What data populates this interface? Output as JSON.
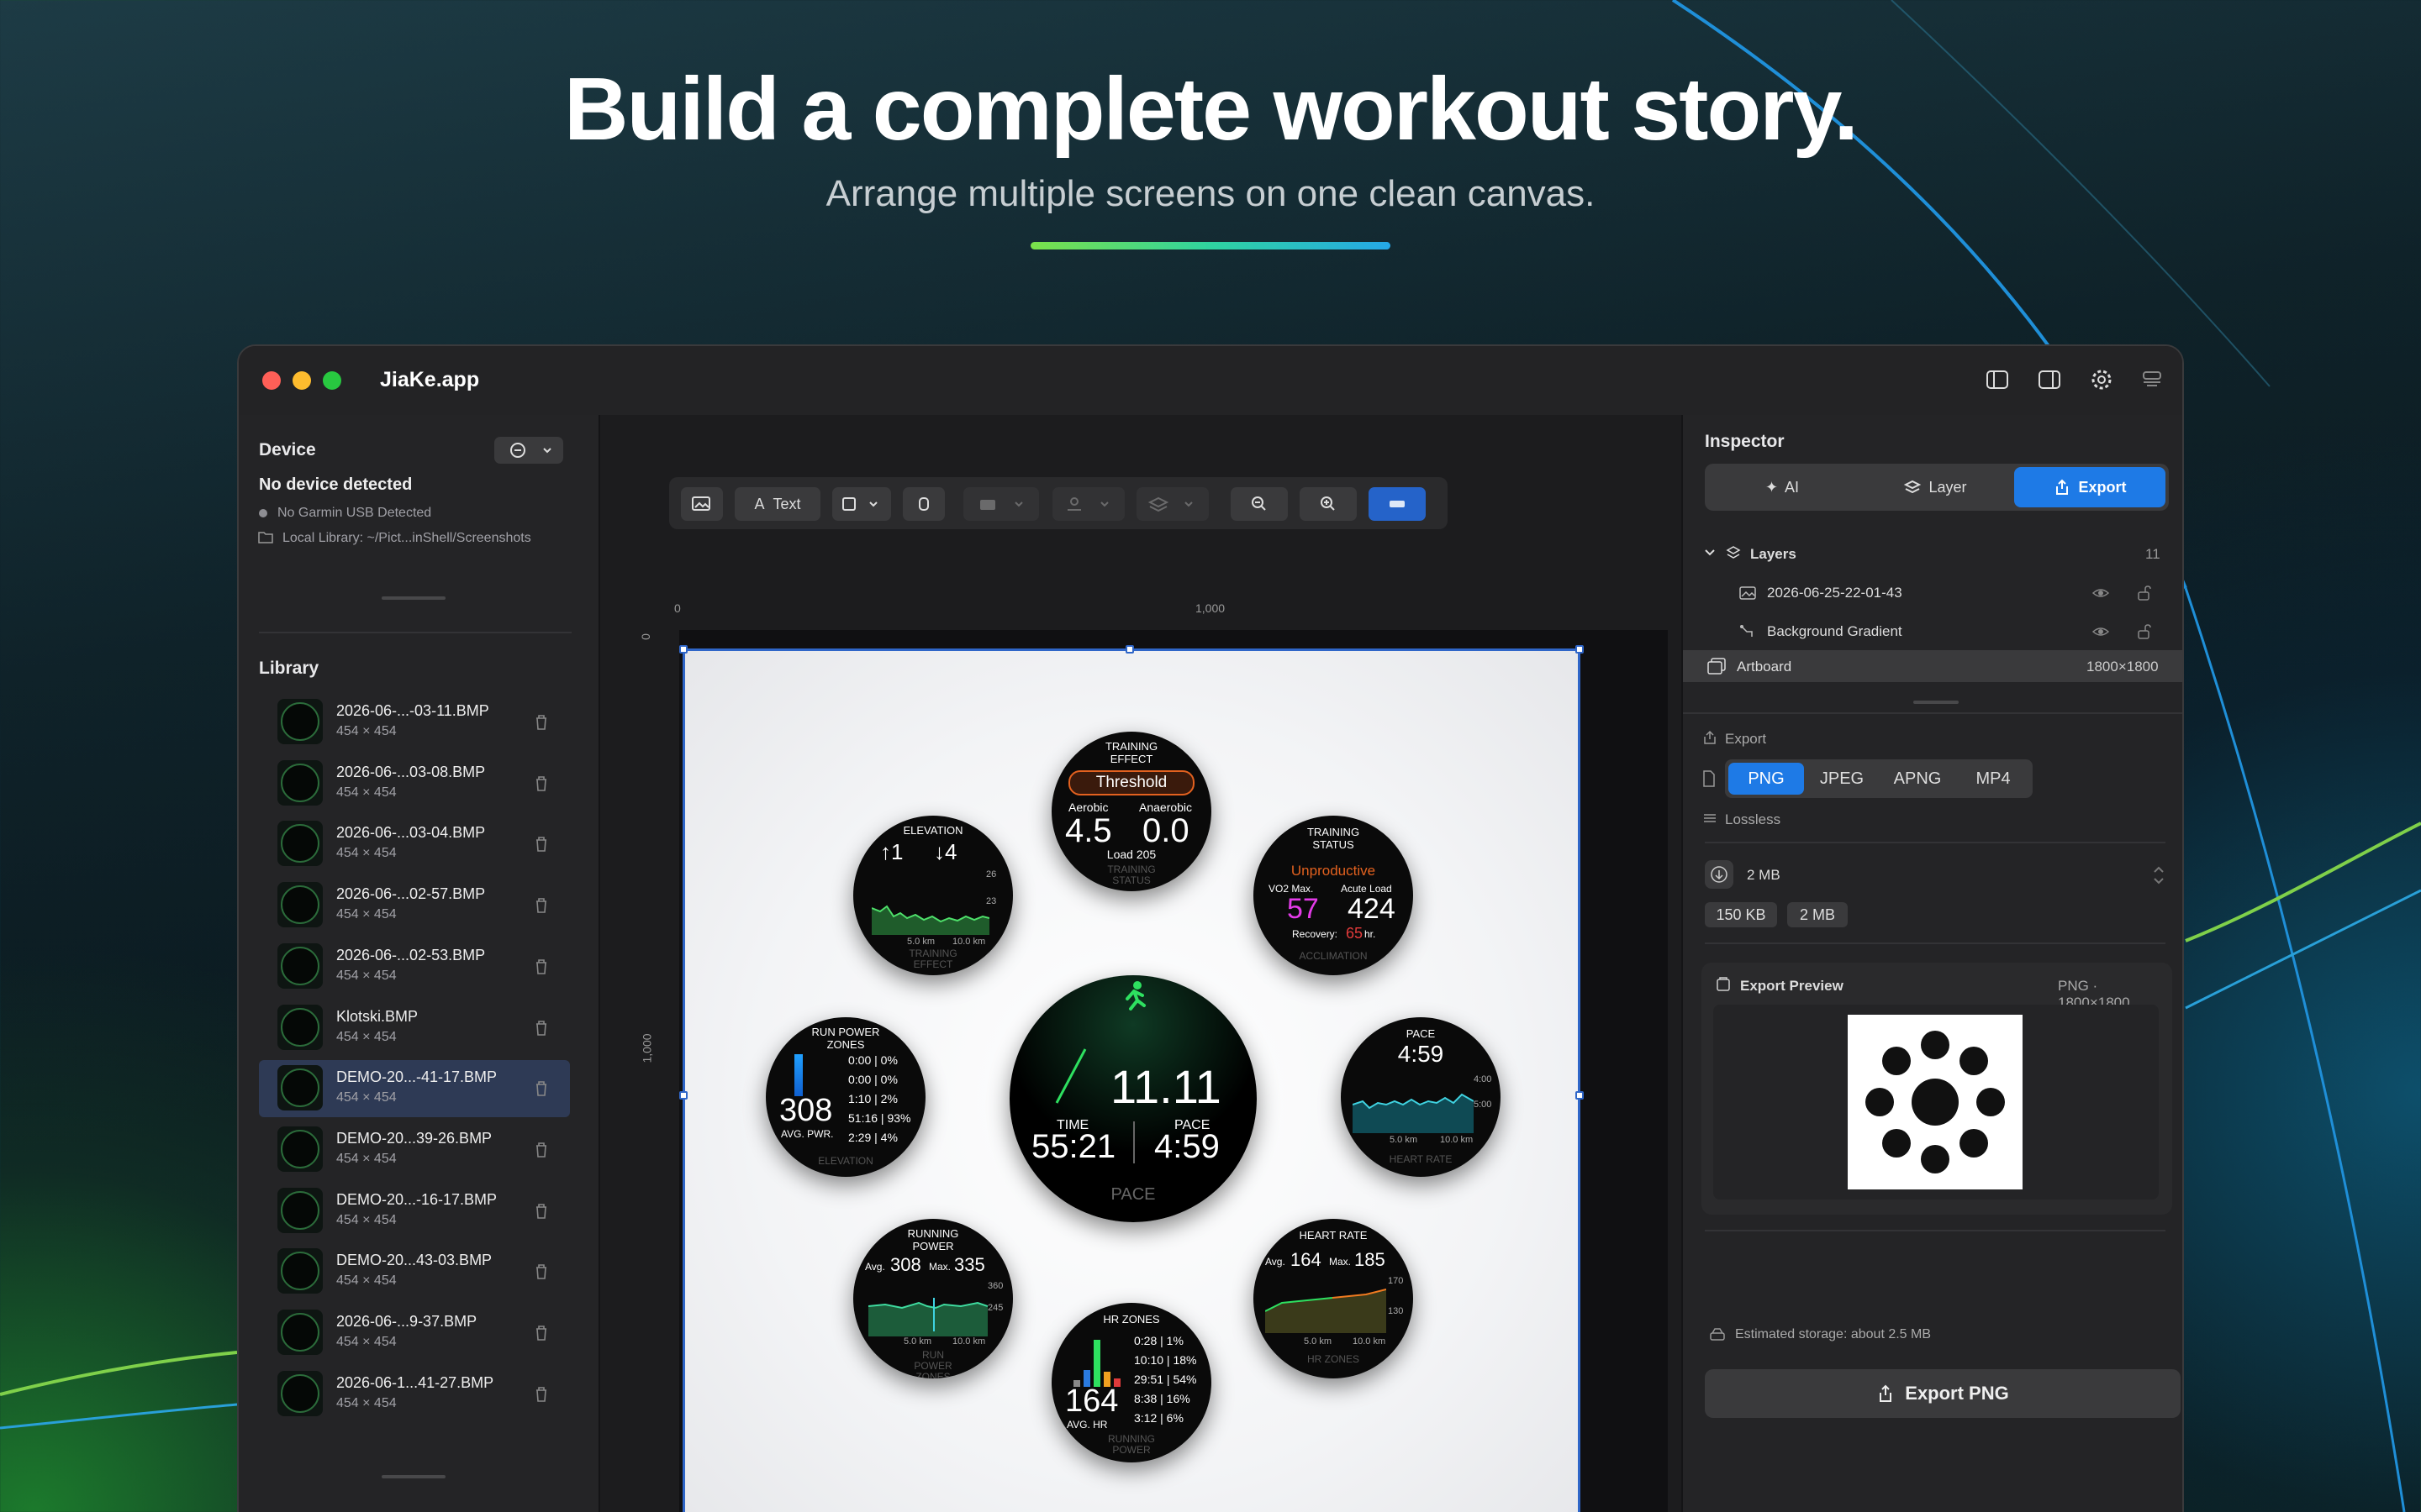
{
  "hero": {
    "title": "Build a complete workout story.",
    "subtitle": "Arrange multiple screens on one clean canvas."
  },
  "app": {
    "name": "JiaKe.app"
  },
  "colors": {
    "accent": "#1e7ae6",
    "selection": "#2f66c8",
    "hero_gradient": [
      "#7be14a",
      "#2fd3a0",
      "#25a8e8"
    ]
  },
  "device": {
    "title": "Device",
    "status": "No device detected",
    "usb": "No Garmin USB Detected",
    "local": "Local Library: ~/Pict...inShell/Screenshots"
  },
  "library": {
    "title": "Library",
    "items": [
      {
        "name": "2026-06-...-03-11.BMP",
        "size": "454 × 454"
      },
      {
        "name": "2026-06-...03-08.BMP",
        "size": "454 × 454"
      },
      {
        "name": "2026-06-...03-04.BMP",
        "size": "454 × 454"
      },
      {
        "name": "2026-06-...02-57.BMP",
        "size": "454 × 454"
      },
      {
        "name": "2026-06-...02-53.BMP",
        "size": "454 × 454"
      },
      {
        "name": "Klotski.BMP",
        "size": "454 × 454"
      },
      {
        "name": "DEMO-20...-41-17.BMP",
        "size": "454 × 454",
        "selected": true
      },
      {
        "name": "DEMO-20...39-26.BMP",
        "size": "454 × 454"
      },
      {
        "name": "DEMO-20...-16-17.BMP",
        "size": "454 × 454"
      },
      {
        "name": "DEMO-20...43-03.BMP",
        "size": "454 × 454"
      },
      {
        "name": "2026-06-...9-37.BMP",
        "size": "454 × 454"
      },
      {
        "name": "2026-06-1...41-27.BMP",
        "size": "454 × 454"
      }
    ]
  },
  "toolbar": {
    "text_label": "Text"
  },
  "ruler": {
    "h0": "0",
    "h1": "1,000",
    "v0": "0",
    "v1": "1,000"
  },
  "watches": {
    "training_effect": {
      "title": "TRAINING EFFECT",
      "badge": "Threshold",
      "aero_label": "Aerobic",
      "aero": "4.5",
      "anaero_label": "Anaerobic",
      "anaero": "0.0",
      "load": "Load 205",
      "footer": "TRAINING STATUS"
    },
    "elevation": {
      "title": "ELEVATION",
      "up": "↑1",
      "down": "↓4",
      "y1": "26",
      "y2": "23",
      "x1": "5.0 km",
      "x2": "10.0 km",
      "footer": "TRAINING EFFECT"
    },
    "training_status": {
      "title": "TRAINING STATUS",
      "status": "Unproductive",
      "vo2_label": "VO2 Max.",
      "vo2": "57",
      "acute_label": "Acute Load",
      "acute": "424",
      "recovery_label": "Recovery:",
      "recovery": "65",
      "recovery_unit": "hr.",
      "footer": "ACCLIMATION"
    },
    "power_zones": {
      "title": "RUN POWER ZONES",
      "avg": "308",
      "avg_label": "AVG. PWR.",
      "rows": [
        "0:00 | 0%",
        "0:00 | 0%",
        "1:10 | 2%",
        "51:16 | 93%",
        "2:29 | 4%"
      ],
      "footer": "ELEVATION"
    },
    "main": {
      "distance": "11.11",
      "time_label": "TIME",
      "time": "55:21",
      "pace_label": "PACE",
      "pace": "4:59",
      "footer": "PACE"
    },
    "pace": {
      "title": "PACE",
      "value": "4:59",
      "y1": "4:00",
      "y2": "5:00",
      "x1": "5.0 km",
      "x2": "10.0 km",
      "footer": "HEART RATE"
    },
    "running_power": {
      "title": "RUNNING POWER",
      "avg_label": "Avg.",
      "avg": "308",
      "max_label": "Max.",
      "max": "335",
      "y1": "360",
      "y2": "245",
      "x1": "5.0 km",
      "x2": "10.0 km",
      "footer": "RUN POWER ZONES"
    },
    "hr_zones": {
      "title": "HR ZONES",
      "avg": "164",
      "avg_label": "AVG. HR",
      "rows": [
        "0:28 | 1%",
        "10:10 | 18%",
        "29:51 | 54%",
        "8:38 | 16%",
        "3:12 | 6%"
      ],
      "footer": "RUNNING POWER"
    },
    "heart_rate": {
      "title": "HEART RATE",
      "avg_label": "Avg.",
      "avg": "164",
      "max_label": "Max.",
      "max": "185",
      "y1": "170",
      "y2": "130",
      "x1": "5.0 km",
      "x2": "10.0 km",
      "footer": "HR ZONES"
    }
  },
  "inspector": {
    "title": "Inspector",
    "tabs": [
      "AI",
      "Layer",
      "Export"
    ],
    "layers_label": "Layers",
    "layers_count": "11",
    "layers": [
      "2026-06-25-22-01-43",
      "Background Gradient"
    ],
    "artboard_label": "Artboard",
    "artboard_size": "1800×1800",
    "export_label": "Export",
    "formats": [
      "PNG",
      "JPEG",
      "APNG",
      "MP4"
    ],
    "lossless": "Lossless",
    "size_value": "2 MB",
    "size_chips": [
      "150 KB",
      "2 MB"
    ],
    "preview_label": "Export Preview",
    "preview_info": "PNG · 1800×1800",
    "storage": "Estimated storage: about 2.5 MB",
    "export_button": "Export PNG"
  }
}
